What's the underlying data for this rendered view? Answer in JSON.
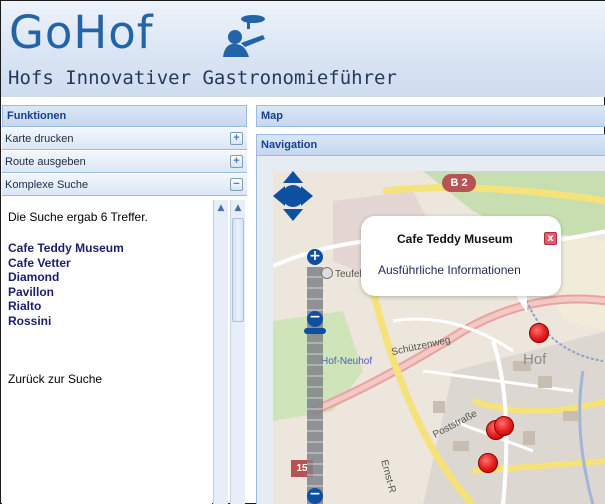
{
  "header": {
    "logo_text": "GoHof",
    "subtitle": "Hofs Innovativer Gastronomieführer"
  },
  "left_panel": {
    "title": "Funktionen",
    "items": [
      {
        "label": "Karte drucken",
        "state": "+"
      },
      {
        "label": "Route ausgeben",
        "state": "+"
      },
      {
        "label": "Komplexe Suche",
        "state": "−"
      }
    ]
  },
  "search_results": {
    "summary": "Die Suche ergab 6 Treffer.",
    "results": [
      "Cafe Teddy Museum",
      "Cafe Vetter",
      "Diamond",
      "Pavillon",
      "Rialto",
      "Rossini"
    ],
    "back_link": "Zurück zur Suche"
  },
  "right_panel": {
    "map_title": "Map",
    "navigation_title": "Navigation"
  },
  "map": {
    "popup": {
      "title": "Cafe Teddy Museum",
      "link": "Ausführliche Informationen",
      "close": "x"
    },
    "labels": {
      "road_b2": "B 2",
      "road_15": "15",
      "teufelsl": "Teufelsl",
      "hof_neuhof": "Hof-Neuhof",
      "schuetzenweg": "Schützenweg",
      "hof": "Hof",
      "poststrasse": "Poststraße",
      "ernst": "Ernst-R"
    },
    "zoom": {
      "plus": "+",
      "minus": "−"
    }
  },
  "colors": {
    "brand_blue": "#2364a8",
    "panel_header_text": "#15428b",
    "marker_red": "#e21a1a"
  }
}
